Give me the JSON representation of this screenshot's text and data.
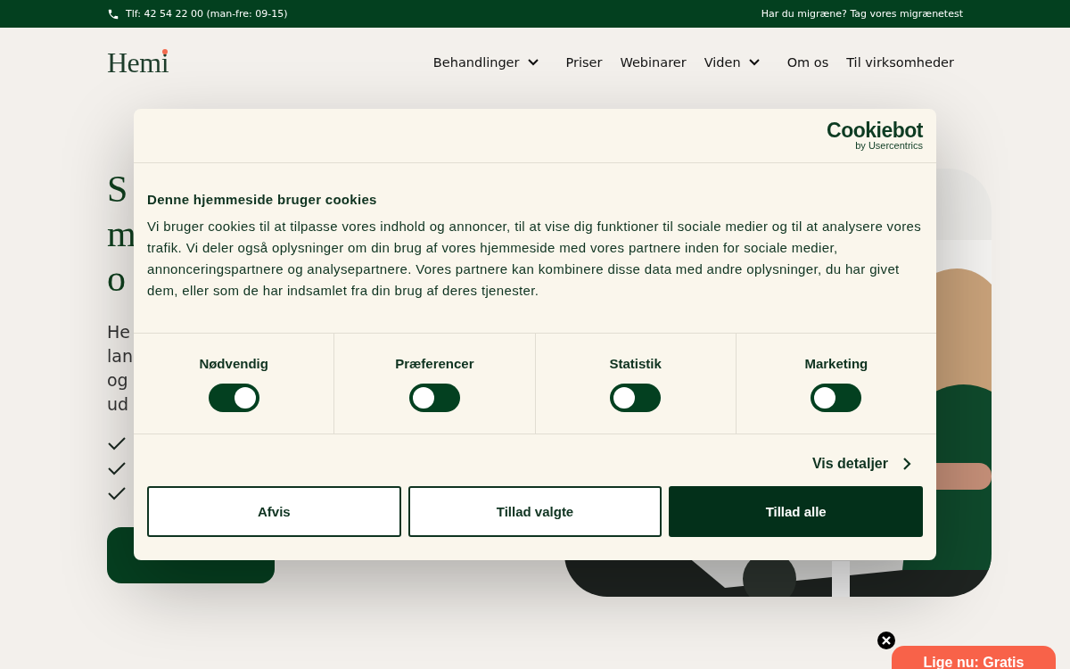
{
  "top_bar": {
    "phone": "Tlf: 42 54 22 00 (man-fre: 09-15)",
    "link": "Har du migræne? Tag vores migrænetest"
  },
  "header": {
    "logo": "Hemi",
    "nav": [
      {
        "label": "Behandlinger",
        "dropdown": true
      },
      {
        "label": "Priser",
        "dropdown": false
      },
      {
        "label": "Webinarer",
        "dropdown": false
      },
      {
        "label": "Viden",
        "dropdown": true
      },
      {
        "label": "Om os",
        "dropdown": false
      },
      {
        "label": "Til virksomheder",
        "dropdown": false
      }
    ]
  },
  "hero": {
    "heading_lines": [
      "S",
      "m",
      "o"
    ],
    "paragraph_lines": [
      "He",
      "lan",
      "og",
      "ud"
    ]
  },
  "cookie_dialog": {
    "brand": "Cookiebot",
    "brand_sub": "by Usercentrics",
    "title": "Denne hjemmeside bruger cookies",
    "body": "Vi bruger cookies til at tilpasse vores indhold og annoncer, til at vise dig funktioner til sociale medier og til at analysere vores trafik. Vi deler også oplysninger om din brug af vores hjemmeside med vores partnere inden for sociale medier, annonceringspartnere og analysepartnere. Vores partnere kan kombinere disse data med andre oplysninger, du har givet dem, eller som de har indsamlet fra din brug af deres tjenester.",
    "categories": [
      {
        "label": "Nødvendig",
        "on": true
      },
      {
        "label": "Præferencer",
        "on": false
      },
      {
        "label": "Statistik",
        "on": false
      },
      {
        "label": "Marketing",
        "on": false
      }
    ],
    "details_link": "Vis detaljer",
    "buttons": [
      {
        "label": "Afvis",
        "kind": "outline"
      },
      {
        "label": "Tillad valgte",
        "kind": "outline"
      },
      {
        "label": "Tillad alle",
        "kind": "primary"
      }
    ]
  },
  "promo": {
    "label": "Lige nu: Gratis"
  }
}
